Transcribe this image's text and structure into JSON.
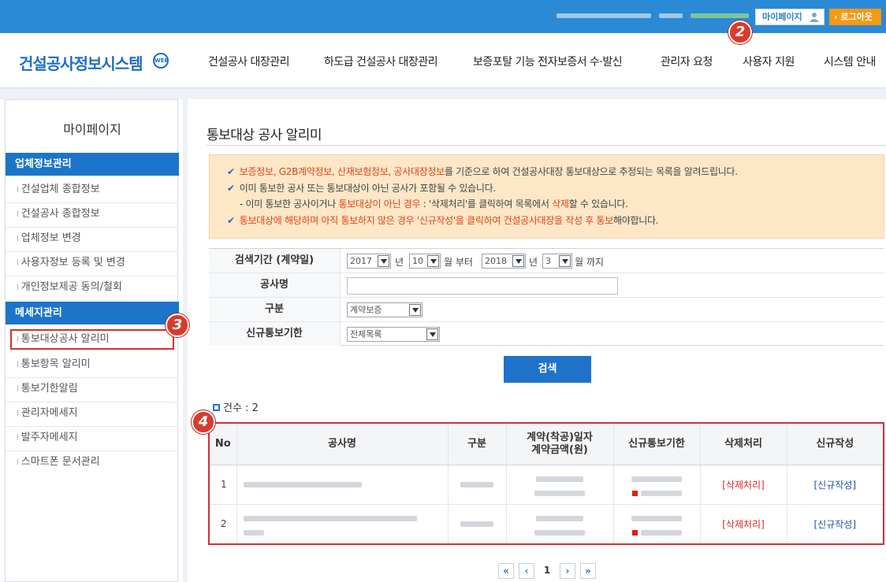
{
  "topbar": {
    "mypage_label": "마이페이지",
    "logout_label": "› 로그아웃"
  },
  "header": {
    "logo_text": "건설공사정보시스템",
    "logo_mark": "WEB",
    "nav": [
      "건설공사 대장관리",
      "하도급 건설공사 대장관리",
      "보증포탈 기능 전자보증서 수·발신",
      "관리자 요청",
      "사용자 지원",
      "시스템 안내"
    ]
  },
  "sidebar": {
    "title": "마이페이지",
    "section1": "업체정보관리",
    "section1_items": [
      "건설업체 종합정보",
      "건설공사 종합정보",
      "업체정보 변경",
      "사용자정보 등록 및 변경",
      "개인정보제공 동의/철회"
    ],
    "section2": "메세지관리",
    "section2_items": [
      "통보대상공사 알리미",
      "통보항목 알리미",
      "통보기한알림",
      "관리자메세지",
      "발주자메세지",
      "스마트폰 문서관리"
    ]
  },
  "main": {
    "title": "통보대상 공사 알리미",
    "notice": {
      "l1_red": "보증정보, G2B계약정보, 산재보험정보, 공사대장정보",
      "l1_rest": "를 기준으로 하여 건설공사대장 통보대상으로 추정되는 목록을 알려드립니다.",
      "l2": "이미 통보한 공사 또는 통보대상이 아닌 공사가 포함될 수 있습니다.",
      "l3_a": "- 이미 통보한 공사이거나 ",
      "l3_b": "통보대상이 아닌 경우",
      "l3_c": " : '삭제처리'를 클릭하여 목록에서 ",
      "l3_d": "삭제",
      "l3_e": "할 수 있습니다.",
      "l4_red": "통보대상에 해당하며 아직 통보하지 않은 경우 '신규작성'을 클릭하여 건설공사대장을 작성 후 통보",
      "l4_rest": "해야합니다."
    },
    "form": {
      "period_label": "검색기간 (계약일)",
      "from_year": "2017",
      "from_year_unit": "년",
      "from_month": "10",
      "from_month_unit": "월 부터",
      "to_year": "2018",
      "to_year_unit": "년",
      "to_month": "3",
      "to_month_unit": "월 까지",
      "name_label": "공사명",
      "name_value": "",
      "type_label": "구분",
      "type_value": "계약보증",
      "deadline_label": "신규통보기한",
      "deadline_value": "전체목록"
    },
    "search_button": "검색",
    "count_text": "건수 : 2",
    "table": {
      "headers": [
        "No",
        "공사명",
        "구분",
        "계약(착공)일자\n계약금액(원)",
        "신규통보기한",
        "삭제처리",
        "신규작성"
      ],
      "rows": [
        {
          "no": "1",
          "delete": "[삭제처리]",
          "create": "[신규작성]"
        },
        {
          "no": "2",
          "delete": "[삭제처리]",
          "create": "[신규작성]"
        }
      ]
    },
    "pager": {
      "first": "«",
      "prev": "‹",
      "current": "1",
      "next": "›",
      "last": "»"
    }
  },
  "badges": [
    "2",
    "3",
    "4"
  ]
}
